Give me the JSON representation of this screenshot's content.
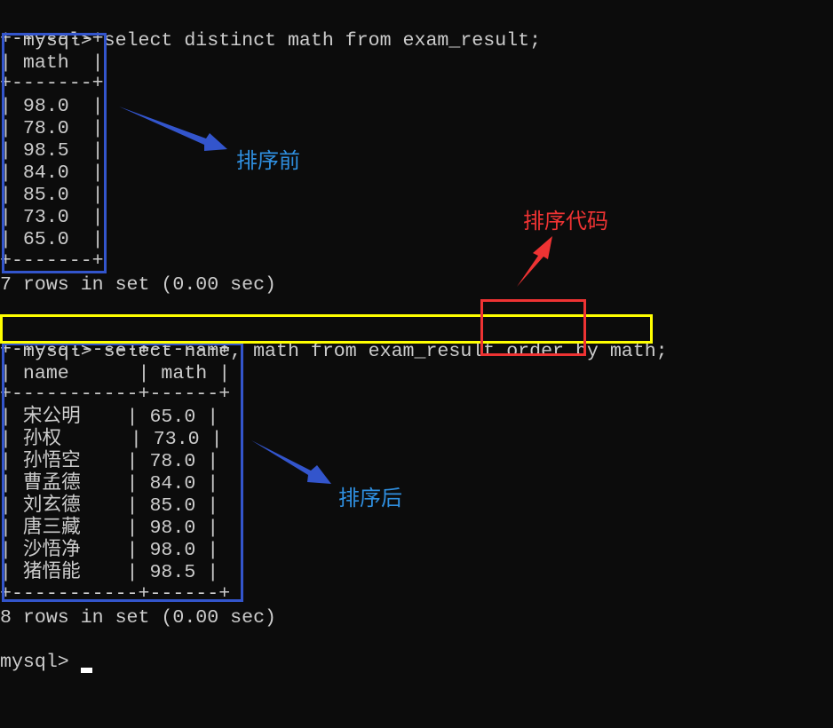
{
  "terminal": {
    "prompt": "mysql> ",
    "query1": "select distinct math from exam_result;",
    "table1": {
      "border": "+-------+",
      "header": "| math  |",
      "rows": [
        "| 98.0  |",
        "| 78.0  |",
        "| 98.5  |",
        "| 84.0  |",
        "| 85.0  |",
        "| 73.0  |",
        "| 65.0  |"
      ]
    },
    "result1": "7 rows in set (0.00 sec)",
    "query2_pre": "select name, math from exam_result ",
    "query2_highlight": "order by",
    "query2_post": " math;",
    "table2": {
      "border": "+-----------+------+",
      "header": "| name      | math |",
      "rows": [
        "| 宋公明    | 65.0 |",
        "| 孙权      | 73.0 |",
        "| 孙悟空    | 78.0 |",
        "| 曹孟德    | 84.0 |",
        "| 刘玄德    | 85.0 |",
        "| 唐三藏    | 98.0 |",
        "| 沙悟净    | 98.0 |",
        "| 猪悟能    | 98.5 |"
      ]
    },
    "result2": "8 rows in set (0.00 sec)",
    "final_prompt": "mysql> "
  },
  "annotations": {
    "before_label": "排序前",
    "after_label": "排序后",
    "code_label": "排序代码",
    "colors": {
      "blue_box": "#3355cc",
      "yellow_box": "#ffff00",
      "red_box": "#ee3333",
      "blue_text": "#2f8fe0",
      "red_text": "#ee3333"
    }
  }
}
